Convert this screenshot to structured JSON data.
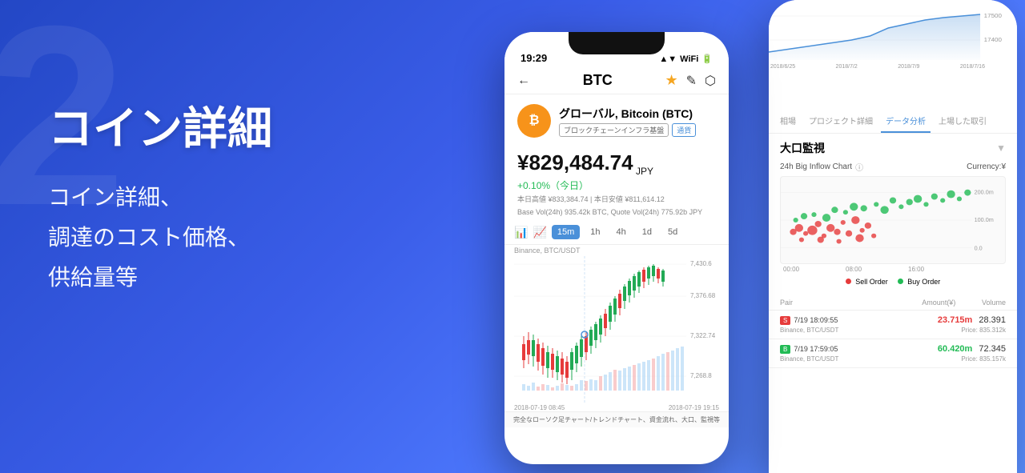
{
  "background": {
    "decorative_text": "2"
  },
  "left_section": {
    "main_title": "コイン詳細",
    "sub_lines": [
      "コイン詳細、",
      "調達のコスト価格、",
      "供給量等"
    ]
  },
  "phone_left": {
    "status_bar": {
      "time": "19:29",
      "icons": "▲ ▼ WiFi"
    },
    "nav": {
      "back": "←",
      "title": "BTC",
      "star": "★",
      "edit": "✎",
      "share": "⬡"
    },
    "coin": {
      "symbol": "₿",
      "name": "グローバル, Bitcoin (BTC)",
      "tag1": "ブロックチェーンインフラ基盤",
      "tag2": "通貨"
    },
    "price": {
      "currency": "¥",
      "amount": "829,484.74",
      "unit": "JPY",
      "change": "+0.10%（今日）",
      "high": "本日高値 ¥833,384.74 | 本日安値 ¥811,614.12",
      "volume": "Base Vol(24h) 935.42k BTC, Quote Vol(24h) 775.92b JPY"
    },
    "chart_tabs": [
      "15m",
      "1h",
      "4h",
      "1d",
      "5d"
    ],
    "active_tab": "15m",
    "chart_source": "Binance, BTC/USDT",
    "price_levels": [
      "7,430.6",
      "7,376.68",
      "7,322.74",
      "7,268.8"
    ],
    "dates": [
      "2018-07-19 08:45",
      "2018-07-19 19:15"
    ],
    "bottom_text": "完全なローソク足チャート/トレンドチャート、資金流れ、大口、監視等"
  },
  "phone_right": {
    "tabs": [
      "相場",
      "プロジェクト詳細",
      "データ分析",
      "上場した取引"
    ],
    "active_tab": "データ分析",
    "whale_section": {
      "title": "大口監視",
      "subtitle": "24h Big Inflow Chart",
      "currency_label": "Currency:¥",
      "currency_y_label": "Currency Y",
      "y_axis": [
        "200.0m",
        "100.0m",
        "0.0"
      ],
      "x_axis": [
        "00:00",
        "08:00",
        "16:00"
      ],
      "legend": {
        "sell": "Sell Order",
        "buy": "Buy Order"
      }
    },
    "top_chart": {
      "y_axis": [
        "17500",
        "17400"
      ],
      "dates": [
        "2018/6/25",
        "2018/7/2",
        "2018/7/9",
        "2018/7/16"
      ]
    },
    "table": {
      "headers": [
        "Pair",
        "Amount(¥)",
        "Volume"
      ],
      "rows": [
        {
          "badge": "S",
          "badge_type": "red",
          "datetime": "7/19 18:09:55",
          "pair": "Binance, BTC/USDT",
          "amount": "23.715m",
          "amount_type": "red",
          "volume": "28.391",
          "price": "Price: 835.312k"
        },
        {
          "badge": "B",
          "badge_type": "green",
          "datetime": "7/19 17:59:05",
          "pair": "Binance, BTC/USDT",
          "amount": "60.420m",
          "amount_type": "green",
          "volume": "72.345",
          "price": "Price: 835.157k"
        }
      ]
    }
  }
}
